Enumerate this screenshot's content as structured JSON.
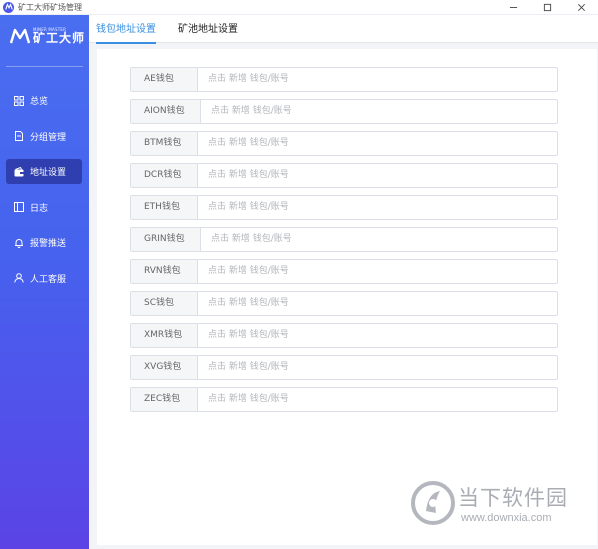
{
  "window": {
    "title": "矿工大师矿场管理"
  },
  "logo": {
    "en": "MINER MASTER",
    "cn": "矿工大师"
  },
  "sidebar": {
    "items": [
      {
        "label": "总览",
        "icon": "grid-icon",
        "active": false
      },
      {
        "label": "分组管理",
        "icon": "document-icon",
        "active": false
      },
      {
        "label": "地址设置",
        "icon": "wallet-icon",
        "active": true
      },
      {
        "label": "日志",
        "icon": "log-icon",
        "active": false
      },
      {
        "label": "报警推送",
        "icon": "bell-icon",
        "active": false
      },
      {
        "label": "人工客服",
        "icon": "user-icon",
        "active": false
      }
    ]
  },
  "tabs": [
    {
      "label": "钱包地址设置",
      "active": true
    },
    {
      "label": "矿池地址设置",
      "active": false
    }
  ],
  "wallets": [
    {
      "label": "AE钱包",
      "placeholder": "点击 新增 钱包/账号"
    },
    {
      "label": "AION钱包",
      "placeholder": "点击 新增 钱包/账号"
    },
    {
      "label": "BTM钱包",
      "placeholder": "点击 新增 钱包/账号"
    },
    {
      "label": "DCR钱包",
      "placeholder": "点击 新增 钱包/账号"
    },
    {
      "label": "ETH钱包",
      "placeholder": "点击 新增 钱包/账号"
    },
    {
      "label": "GRIN钱包",
      "placeholder": "点击 新增 钱包/账号"
    },
    {
      "label": "RVN钱包",
      "placeholder": "点击 新增 钱包/账号"
    },
    {
      "label": "SC钱包",
      "placeholder": "点击 新增 钱包/账号"
    },
    {
      "label": "XMR钱包",
      "placeholder": "点击 新增 钱包/账号"
    },
    {
      "label": "XVG钱包",
      "placeholder": "点击 新增 钱包/账号"
    },
    {
      "label": "ZEC钱包",
      "placeholder": "点击 新增 钱包/账号"
    }
  ],
  "watermark": {
    "cn": "当下软件园",
    "url": "www.downxia.com"
  },
  "colors": {
    "accent": "#3a8fe0",
    "sidebar_top": "#4a6ef0",
    "sidebar_bottom": "#5b43e6",
    "sidebar_active": "#2f3fb0"
  }
}
